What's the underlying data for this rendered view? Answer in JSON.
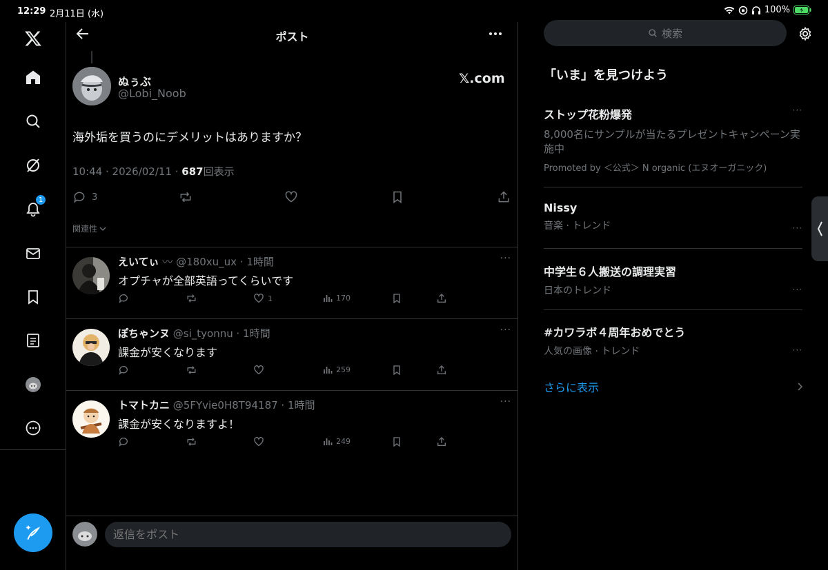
{
  "status_bar": {
    "time": "12:29",
    "date": "2月11日 (水)",
    "battery": "100%"
  },
  "header": {
    "title": "ポスト"
  },
  "post": {
    "author_name": "ぬぅぶ",
    "author_handle": "@Lobi_Noob",
    "source_label": "𝕏.com",
    "text": "海外垢を買うのにデメリットはありますか？",
    "time": "10:44 · 2026/02/11 · ",
    "views": "687",
    "views_label": "回表示",
    "reply_count": "3",
    "sort_label": "関連性"
  },
  "replies": [
    {
      "name": "えいてぃ",
      "name_suffix": "〰",
      "handle_time": "@180xu_ux · 1時間",
      "text": "オプチャが全部英語ってくらいです",
      "likes": "1",
      "views": "170"
    },
    {
      "name": "ぽちゃンヌ",
      "name_suffix": "",
      "handle_time": "@si_tyonnu · 1時間",
      "text": "課金が安くなります",
      "likes": "",
      "views": "259"
    },
    {
      "name": "トマトカニ",
      "name_suffix": "",
      "handle_time": "@5FYvie0H8T94187 · 1時間",
      "text": "課金が安くなりますよ！",
      "likes": "",
      "views": "249"
    }
  ],
  "reply_box": {
    "placeholder": "返信をポスト"
  },
  "nav": {
    "notification_badge": "1"
  },
  "sidebar": {
    "search_placeholder": "検索",
    "section_title": "「いま」を見つけよう",
    "trends": [
      {
        "title": "ストップ花粉爆発",
        "desc": "8,000名にサンプルが当たるプレゼントキャンペーン実施中",
        "meta": "Promoted by ＜公式＞ N organic (エヌオーガニック)"
      },
      {
        "title": "Nissy",
        "meta": "音楽 · トレンド"
      },
      {
        "title": "中学生６人搬送の調理実習",
        "meta": "日本のトレンド"
      },
      {
        "title": "#カワラボ４周年おめでとう",
        "meta": "人気の画像 · トレンド"
      }
    ],
    "show_more": "さらに表示"
  },
  "colors": {
    "accent": "#1d9bf0",
    "background": "#000000",
    "text": "#e7e9ea",
    "muted": "#71767b",
    "divider": "#2f3336",
    "battery": "#4cd964"
  }
}
